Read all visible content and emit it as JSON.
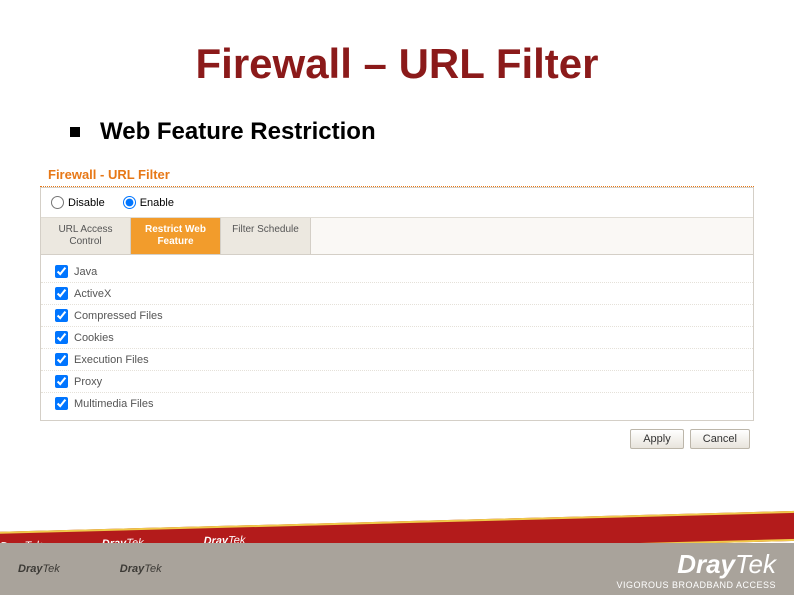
{
  "title": "Firewall – URL Filter",
  "subtitle": "Web Feature Restriction",
  "panel": {
    "title": "Firewall - URL Filter",
    "radios": [
      "Disable",
      "Enable"
    ],
    "selected_radio": "Enable",
    "tabs": [
      {
        "label": "URL Access Control",
        "active": false
      },
      {
        "label": "Restrict Web Feature",
        "active": true
      },
      {
        "label": "Filter Schedule",
        "active": false
      }
    ],
    "checks": [
      "Java",
      "ActiveX",
      "Compressed Files",
      "Cookies",
      "Execution Files",
      "Proxy",
      "Multimedia Files"
    ],
    "buttons": {
      "apply": "Apply",
      "cancel": "Cancel"
    }
  },
  "footer": {
    "brand_bold": "Dray",
    "brand_light": "Tek",
    "tagline": "VIGOROUS BROADBAND ACCESS"
  }
}
